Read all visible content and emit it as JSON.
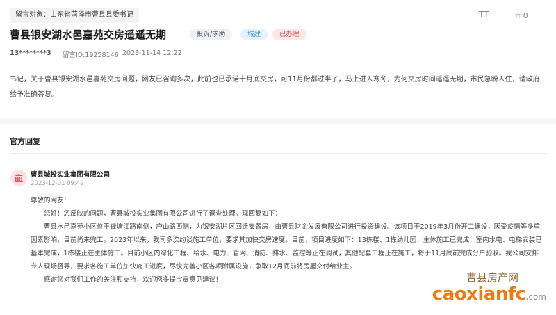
{
  "header": {
    "recipient": "留言对象：山东省菏泽市曹县县委书记",
    "font_size_label": "TT",
    "favorite_count": "0"
  },
  "message": {
    "title": "曹县银安湖水邑嘉苑交房遥遥无期",
    "badges": {
      "type": "投诉/求助",
      "field": "城建",
      "status": "已办理"
    },
    "user": "13********3",
    "id": "留言ID:19258146",
    "time": "2023-11-14 12:22",
    "body": "书记，关于曹县银安湖水邑嘉苑交房问题，网友已咨询多次，此前也已承诺十月底交房，可11月份都过半了，马上进入寒冬，为何交房时间遥遥无期，市民急盼入住，请政府给予准确答复。"
  },
  "reply": {
    "section_title": "官方回复",
    "org": "曹县城投实业集团有限公司",
    "time": "2023-12-01 09:49",
    "greeting": "尊敬的网友：",
    "p1": "您好！您反映的问题，曹县城投实业集团有限公司进行了调查处理。现回复如下：",
    "p2": "曹县水邑嘉苑小区位于钱塘江路南侧，庐山路西侧，为银安湖片区回迁安置房，由曹县财金发展有限公司进行投资建设。该项目于2019年3月份开工建设，因受疫情等多重因素影响，目前尚未完工。2023年以来，我司多次约谈施工单位，要求其加快交房速度。目前，项目进度如下：13栋楼、1栋幼儿园、主体施工已完成，室内水电、电梯安装已基本完成，1栋楼正在主体施工。目前小区内绿化工程、给水、电力、管网、消防、排水、监控等正在调试，其他配套工程正在施工，将于11月底前完成分户验收。我公司安排专人现场督导，要求各施工单位加快施工进度，尽快完善小区各项附属设施，争取12月底前将房屋交付给业主。",
    "p3": "感谢您对我们工作的关注和支持，欢迎您多提宝贵意见建议！"
  },
  "watermark": {
    "cn": "曹县房产网",
    "en": "caoxianfc",
    "suffix": ".com"
  }
}
